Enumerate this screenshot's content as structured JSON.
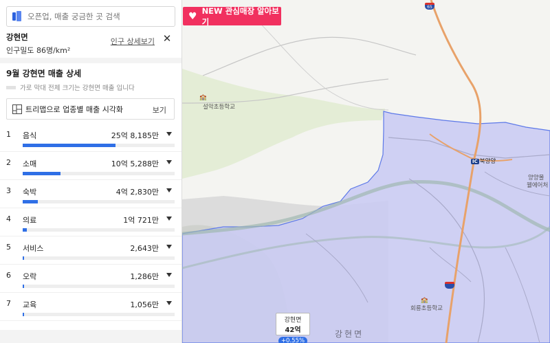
{
  "search": {
    "placeholder": "오픈업, 매출 궁금한 곳 검색"
  },
  "region": {
    "name": "강현면",
    "density": "인구밀도 86명/km²",
    "population_link": "인구 상세보기",
    "close_icon": "close-icon"
  },
  "sales": {
    "title": "9월 강현면 매출 상세",
    "legend_text": "가로 막대 전체 크기는 강현면 매출 입니다",
    "treemap_label": "트리맵으로 업종별 매출 시각화",
    "treemap_view": "보기",
    "items": [
      {
        "rank": "1",
        "label": "음식",
        "value": "25억 8,185만",
        "share": 0.61
      },
      {
        "rank": "2",
        "label": "소매",
        "value": "10억 5,288만",
        "share": 0.25
      },
      {
        "rank": "3",
        "label": "숙박",
        "value": "4억 2,830만",
        "share": 0.1
      },
      {
        "rank": "4",
        "label": "의료",
        "value": "1억 721만",
        "share": 0.025
      },
      {
        "rank": "5",
        "label": "서비스",
        "value": "2,643만",
        "share": 0.006
      },
      {
        "rank": "6",
        "label": "오락",
        "value": "1,286만",
        "share": 0.003
      },
      {
        "rank": "7",
        "label": "교육",
        "value": "1,056만",
        "share": 0.0025
      }
    ]
  },
  "map": {
    "new_button": "NEW 관심매장 알아보기",
    "labels": {
      "school1": "설악초등학교",
      "school2": "회룡초등학교",
      "ic": "북양양",
      "ic_badge": "IC",
      "right_label_1": "양양몰",
      "right_label_2": "웰에어처",
      "area": "강현면",
      "highway_no": "65"
    },
    "marker": {
      "name": "강현면",
      "value": "42억",
      "change": "+0.55%"
    },
    "colors": {
      "region_fill": "#c8caf5",
      "region_border": "#5c78e8",
      "highway": "#e8a26a",
      "forest": "#dfe9c9",
      "river": "#9fb8b0"
    }
  }
}
